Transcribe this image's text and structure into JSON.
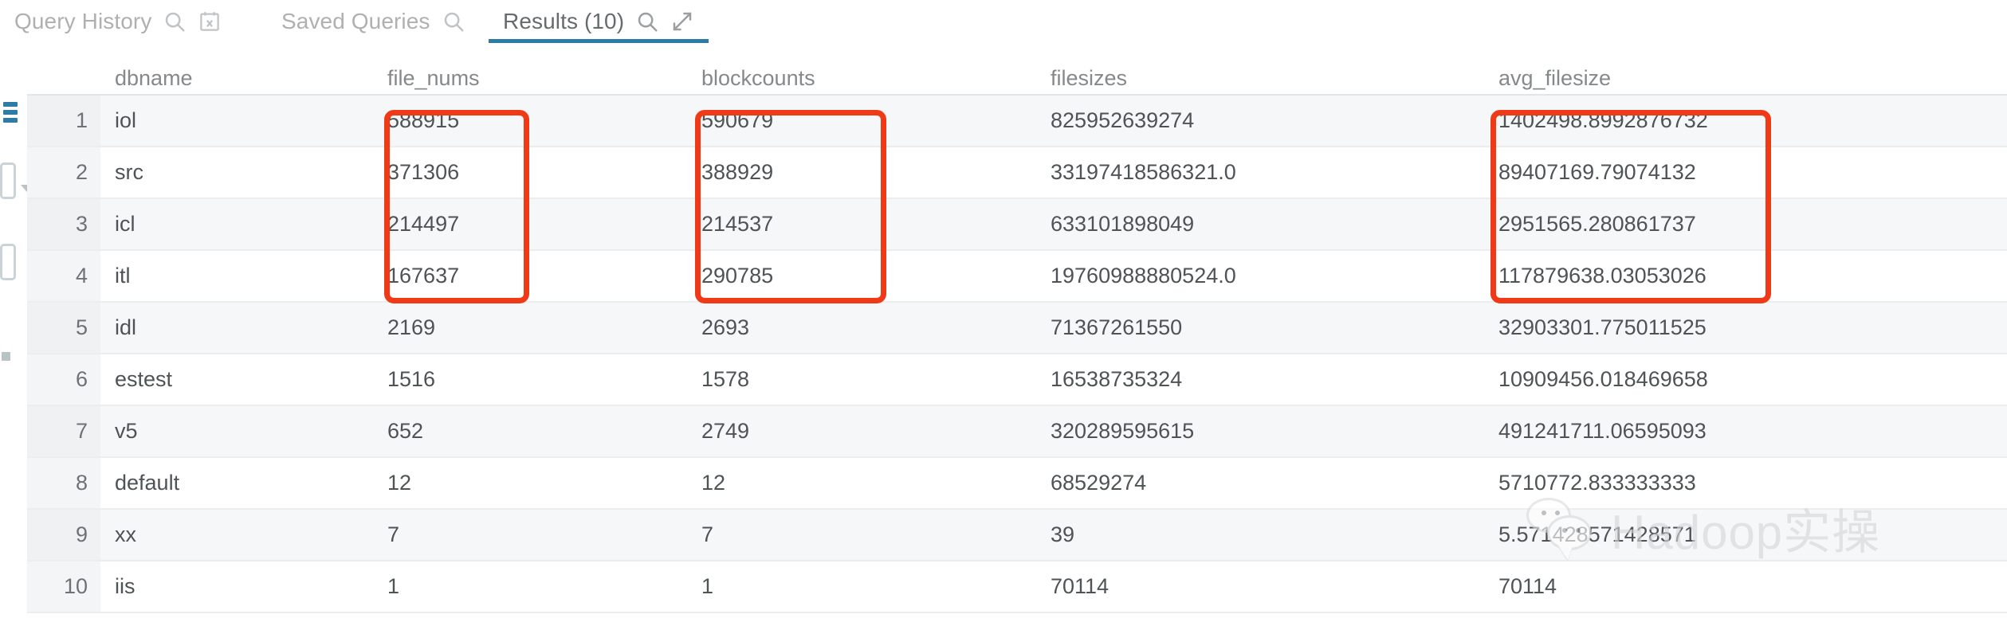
{
  "tabs": [
    {
      "label": "Query History",
      "active": false,
      "icons": [
        "search-icon",
        "calendar-clear-icon"
      ]
    },
    {
      "label": "Saved Queries",
      "active": false,
      "icons": [
        "search-icon"
      ]
    },
    {
      "label": "Results (10)",
      "active": true,
      "icons": [
        "search-icon",
        "expand-icon"
      ]
    }
  ],
  "accent_color": "#2e7ba6",
  "highlight_color": "#f03a17",
  "table": {
    "row_number_header": "",
    "columns": [
      "dbname",
      "file_nums",
      "blockcounts",
      "filesizes",
      "avg_filesize"
    ],
    "rows": [
      {
        "n": "1",
        "dbname": "iol",
        "file_nums": "588915",
        "blockcounts": "590679",
        "filesizes": "825952639274",
        "avg_filesize": "1402498.8992876732"
      },
      {
        "n": "2",
        "dbname": "src",
        "file_nums": "371306",
        "blockcounts": "388929",
        "filesizes": "33197418586321.0",
        "avg_filesize": "89407169.79074132"
      },
      {
        "n": "3",
        "dbname": "icl",
        "file_nums": "214497",
        "blockcounts": "214537",
        "filesizes": "633101898049",
        "avg_filesize": "2951565.280861737"
      },
      {
        "n": "4",
        "dbname": "itl",
        "file_nums": "167637",
        "blockcounts": "290785",
        "filesizes": "19760988880524.0",
        "avg_filesize": "117879638.03053026"
      },
      {
        "n": "5",
        "dbname": "idl",
        "file_nums": "2169",
        "blockcounts": "2693",
        "filesizes": "71367261550",
        "avg_filesize": "32903301.775011525"
      },
      {
        "n": "6",
        "dbname": "estest",
        "file_nums": "1516",
        "blockcounts": "1578",
        "filesizes": "16538735324",
        "avg_filesize": "10909456.018469658"
      },
      {
        "n": "7",
        "dbname": "v5",
        "file_nums": "652",
        "blockcounts": "2749",
        "filesizes": "320289595615",
        "avg_filesize": "491241711.06595093"
      },
      {
        "n": "8",
        "dbname": "default",
        "file_nums": "12",
        "blockcounts": "12",
        "filesizes": "68529274",
        "avg_filesize": "5710772.833333333"
      },
      {
        "n": "9",
        "dbname": "xx",
        "file_nums": "7",
        "blockcounts": "7",
        "filesizes": "39",
        "avg_filesize": "5.571428571428571"
      },
      {
        "n": "10",
        "dbname": "iis",
        "file_nums": "1",
        "blockcounts": "1",
        "filesizes": "70114",
        "avg_filesize": "70114"
      }
    ]
  },
  "annotations": {
    "boxes": [
      {
        "target_column": "file_nums",
        "rows": "1-3"
      },
      {
        "target_column": "blockcounts",
        "rows": "1-3"
      },
      {
        "target_column": "avg_filesize",
        "rows": "1-3"
      }
    ]
  },
  "watermark": {
    "text": "Hadoop实操"
  }
}
